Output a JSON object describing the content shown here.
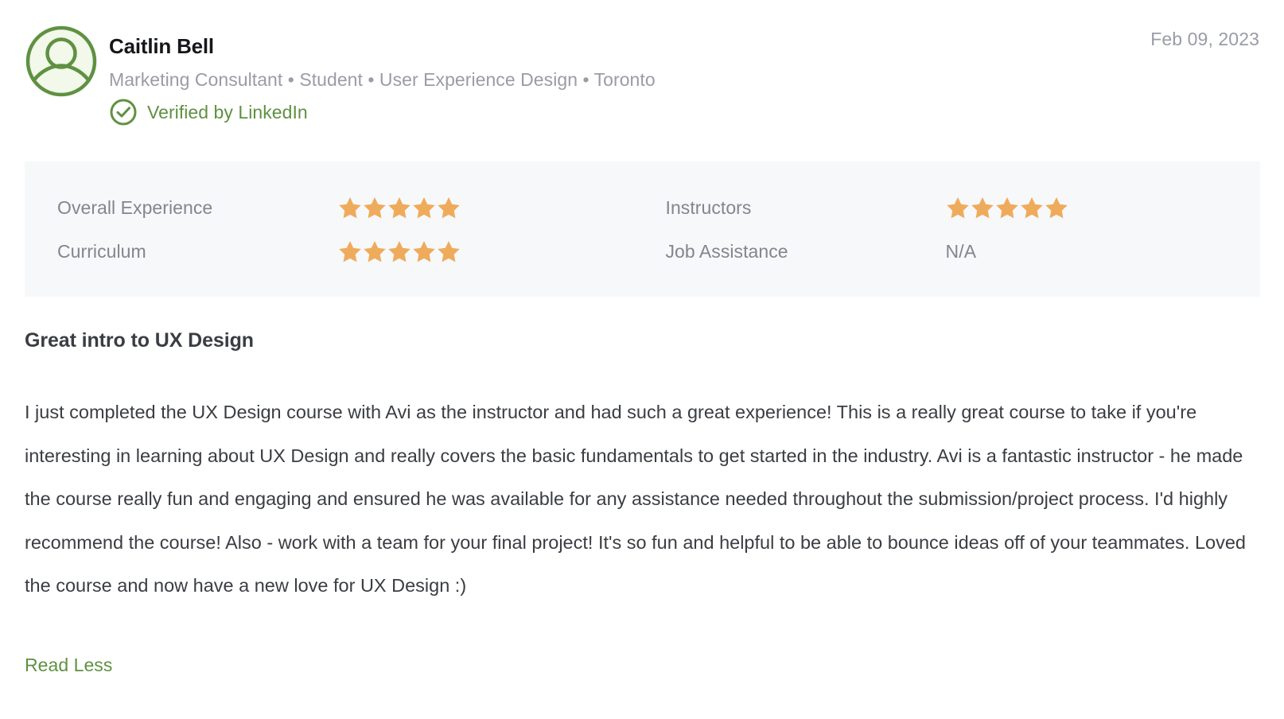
{
  "review": {
    "reviewer": {
      "name": "Caitlin Bell",
      "meta": "Marketing Consultant • Student • User Experience Design • Toronto",
      "avatar_icon": "user-avatar-icon",
      "verified": {
        "icon": "check-circle-icon",
        "label": "Verified by LinkedIn"
      }
    },
    "date": "Feb 09, 2023",
    "ratings": [
      {
        "label": "Overall Experience",
        "value": 5,
        "display": "stars",
        "column": "left"
      },
      {
        "label": "Instructors",
        "value": 5,
        "display": "stars",
        "column": "right"
      },
      {
        "label": "Curriculum",
        "value": 5,
        "display": "stars",
        "column": "left"
      },
      {
        "label": "Job Assistance",
        "value": null,
        "display": "N/A",
        "column": "right"
      }
    ],
    "title": "Great intro to UX Design",
    "body": "I just completed the UX Design course with Avi as the instructor and had such a great experience! This is a really great course to take if you're interesting in learning about UX Design and really covers the basic fundamentals to get started in the industry. Avi is a fantastic instructor - he made the course really fun and engaging and ensured he was available for any assistance needed throughout the submission/project process. I'd highly recommend the course! Also - work with a team for your final project! It's so fun and helpful to be able to bounce ideas off of your teammates. Loved the course and now have a new love for UX Design :)",
    "read_toggle_label": "Read Less"
  },
  "colors": {
    "star": "#efab5c",
    "verified_green": "#5f9141",
    "link_green": "#5f9141",
    "panel_background": "#f7f8fa",
    "muted_text": "#9a9ca6",
    "label_text": "#83858f",
    "body_text": "#3a3d42",
    "name_text": "#15171a"
  }
}
